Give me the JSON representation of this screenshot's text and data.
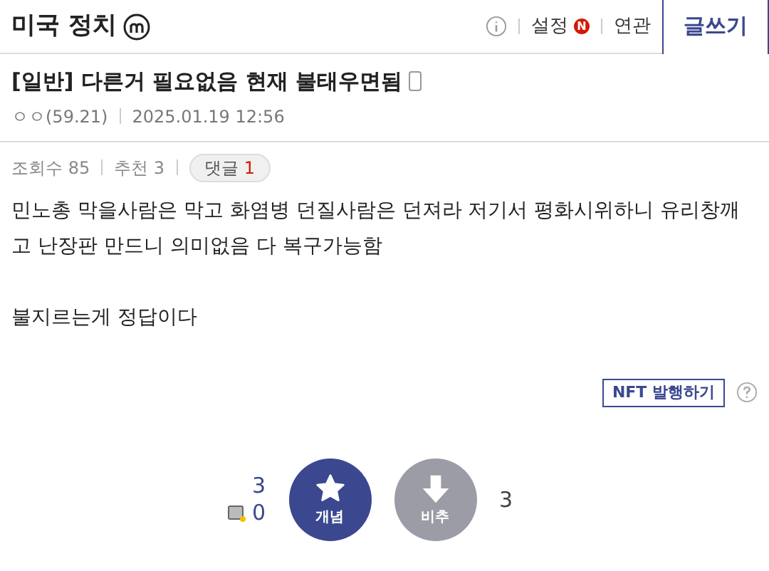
{
  "board": {
    "title": "미국 정치",
    "menu": [
      {
        "label": "설정",
        "new_badge": "N"
      },
      {
        "label": "연관"
      }
    ],
    "write_button": "글쓰기"
  },
  "post": {
    "category": "[일반]",
    "title": "다른거 필요없음 현재 불태우면됨",
    "author": "ㅇㅇ(59.21)",
    "date": "2025.01.19 12:56",
    "stats": [
      {
        "label": "조회수 85"
      },
      {
        "label": "추천 3"
      }
    ],
    "comments": {
      "label": "댓글",
      "count": "1"
    },
    "body": [
      "민노총 막을사람은 막고 화염병 던질사람은 던져라 저기서 평화시위하니 유리창깨고 난장판 만드니 의미없음 다 복구가능함",
      "불지르는게 정답이다"
    ],
    "nft_button": "NFT 발행하기",
    "votes": {
      "up_count": "3",
      "fixed_count": "0",
      "up_label": "개념",
      "down_label": "비추",
      "down_count": "3"
    }
  }
}
